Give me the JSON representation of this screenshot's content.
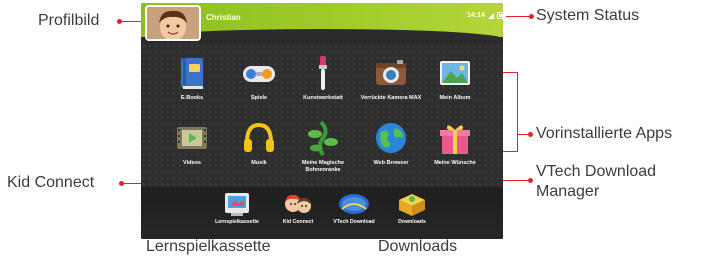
{
  "callouts": {
    "profile_picture": "Profilbild",
    "system_status": "System Status",
    "preinstalled_apps": "Vorinstallierte Apps",
    "kid_connect": "Kid Connect",
    "download_manager_line1": "VTech Download",
    "download_manager_line2": "Manager",
    "cartridge": "Lernspielkassette",
    "downloads": "Downloads"
  },
  "screen": {
    "username": "Christian",
    "time": "14:14",
    "apps_row1": [
      {
        "label": "E-Books",
        "icon": "book-icon"
      },
      {
        "label": "Spiele",
        "icon": "gamepad-icon"
      },
      {
        "label": "Kunstwerkstatt",
        "icon": "paintbrush-icon"
      },
      {
        "label": "Verrückte Kamera MAX",
        "icon": "camera-icon"
      },
      {
        "label": "Mein Album",
        "icon": "photo-album-icon"
      }
    ],
    "apps_row2": [
      {
        "label": "Videos",
        "icon": "film-icon"
      },
      {
        "label": "Musik",
        "icon": "headphones-icon"
      },
      {
        "label": "Meine Magische Bohnenranke",
        "icon": "beanstalk-icon"
      },
      {
        "label": "Web Browser",
        "icon": "globe-icon"
      },
      {
        "label": "Meine Wünsche",
        "icon": "gift-icon"
      }
    ],
    "dock": [
      {
        "label": "Lernspielkassette",
        "icon": "cartridge-icon"
      },
      {
        "label": "Kid Connect",
        "icon": "kid-connect-icon"
      },
      {
        "label": "VTech Download",
        "icon": "download-manager-icon",
        "badge": "VTech Download Manager"
      },
      {
        "label": "Downloads",
        "icon": "downloads-icon"
      }
    ]
  },
  "colors": {
    "callout_line": "#e2232a",
    "topbar_green": "#9ac827",
    "screen_bg": "#2b2b2b"
  }
}
